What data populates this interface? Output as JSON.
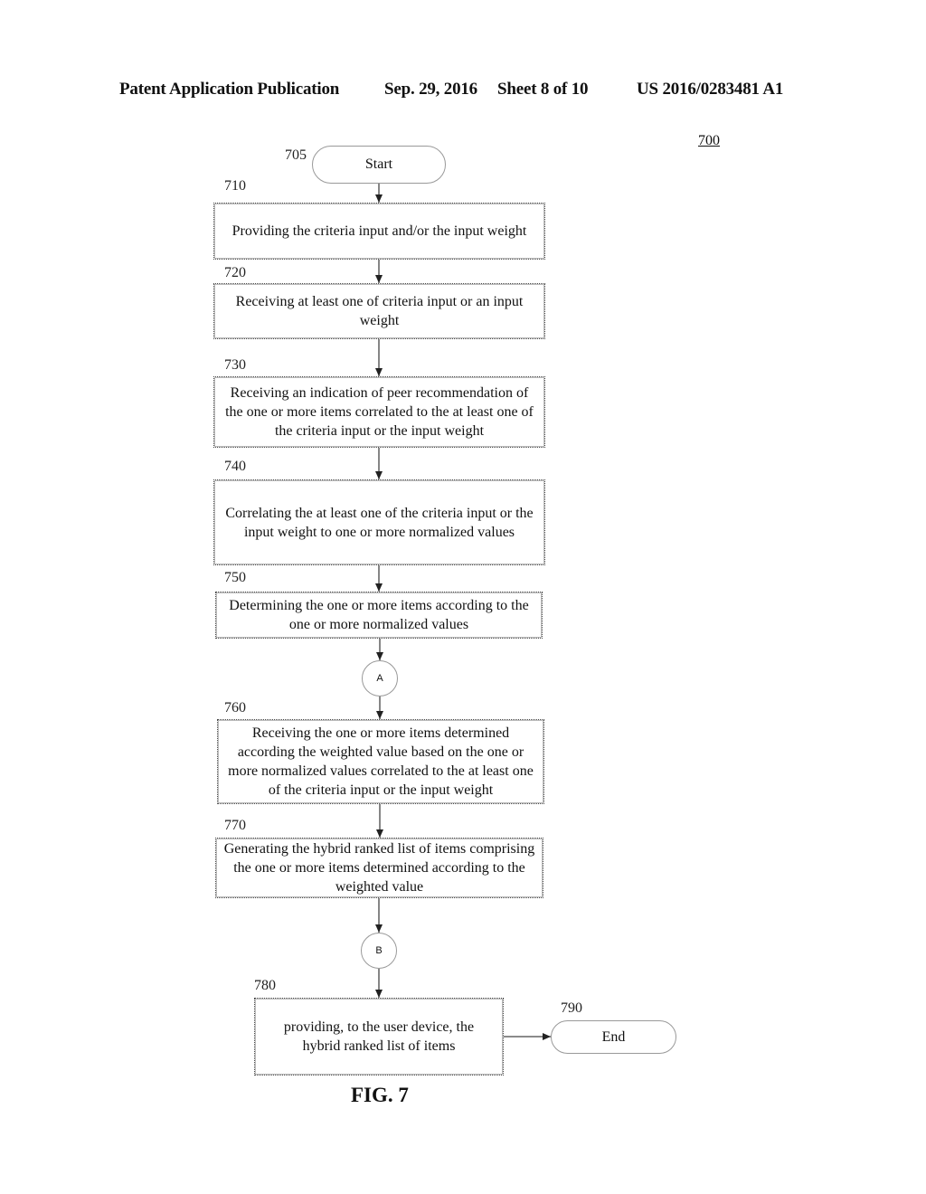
{
  "header": {
    "publication": "Patent Application Publication",
    "date": "Sep. 29, 2016",
    "sheet": "Sheet 8 of 10",
    "number": "US 2016/0283481 A1"
  },
  "figure": {
    "ref": "700",
    "caption": "FIG. 7",
    "start": {
      "ref": "705",
      "label": "Start"
    },
    "steps": [
      {
        "ref": "710",
        "text": "Providing the criteria input and/or the input weight"
      },
      {
        "ref": "720",
        "text": "Receiving at least one of criteria input or an input weight"
      },
      {
        "ref": "730",
        "text": "Receiving an  indication of peer recommendation of the one or more items correlated to the at least one of the criteria input or the input weight"
      },
      {
        "ref": "740",
        "text": "Correlating the at least one of the criteria input or the input weight to one or more normalized values"
      },
      {
        "ref": "750",
        "text": "Determining the one or more items according to the one or more normalized values"
      },
      {
        "ref": "760",
        "text": "Receiving the one or more items determined according the weighted value based on the one or more normalized values correlated to the at least one of the criteria input or the input weight"
      },
      {
        "ref": "770",
        "text": "Generating the hybrid ranked list of items comprising the one or more items determined according to the weighted value"
      },
      {
        "ref": "780",
        "text": "providing, to the user device, the hybrid ranked list of items"
      }
    ],
    "connectors": [
      {
        "label": "A"
      },
      {
        "label": "B"
      }
    ],
    "end": {
      "ref": "790",
      "label": "End"
    }
  }
}
